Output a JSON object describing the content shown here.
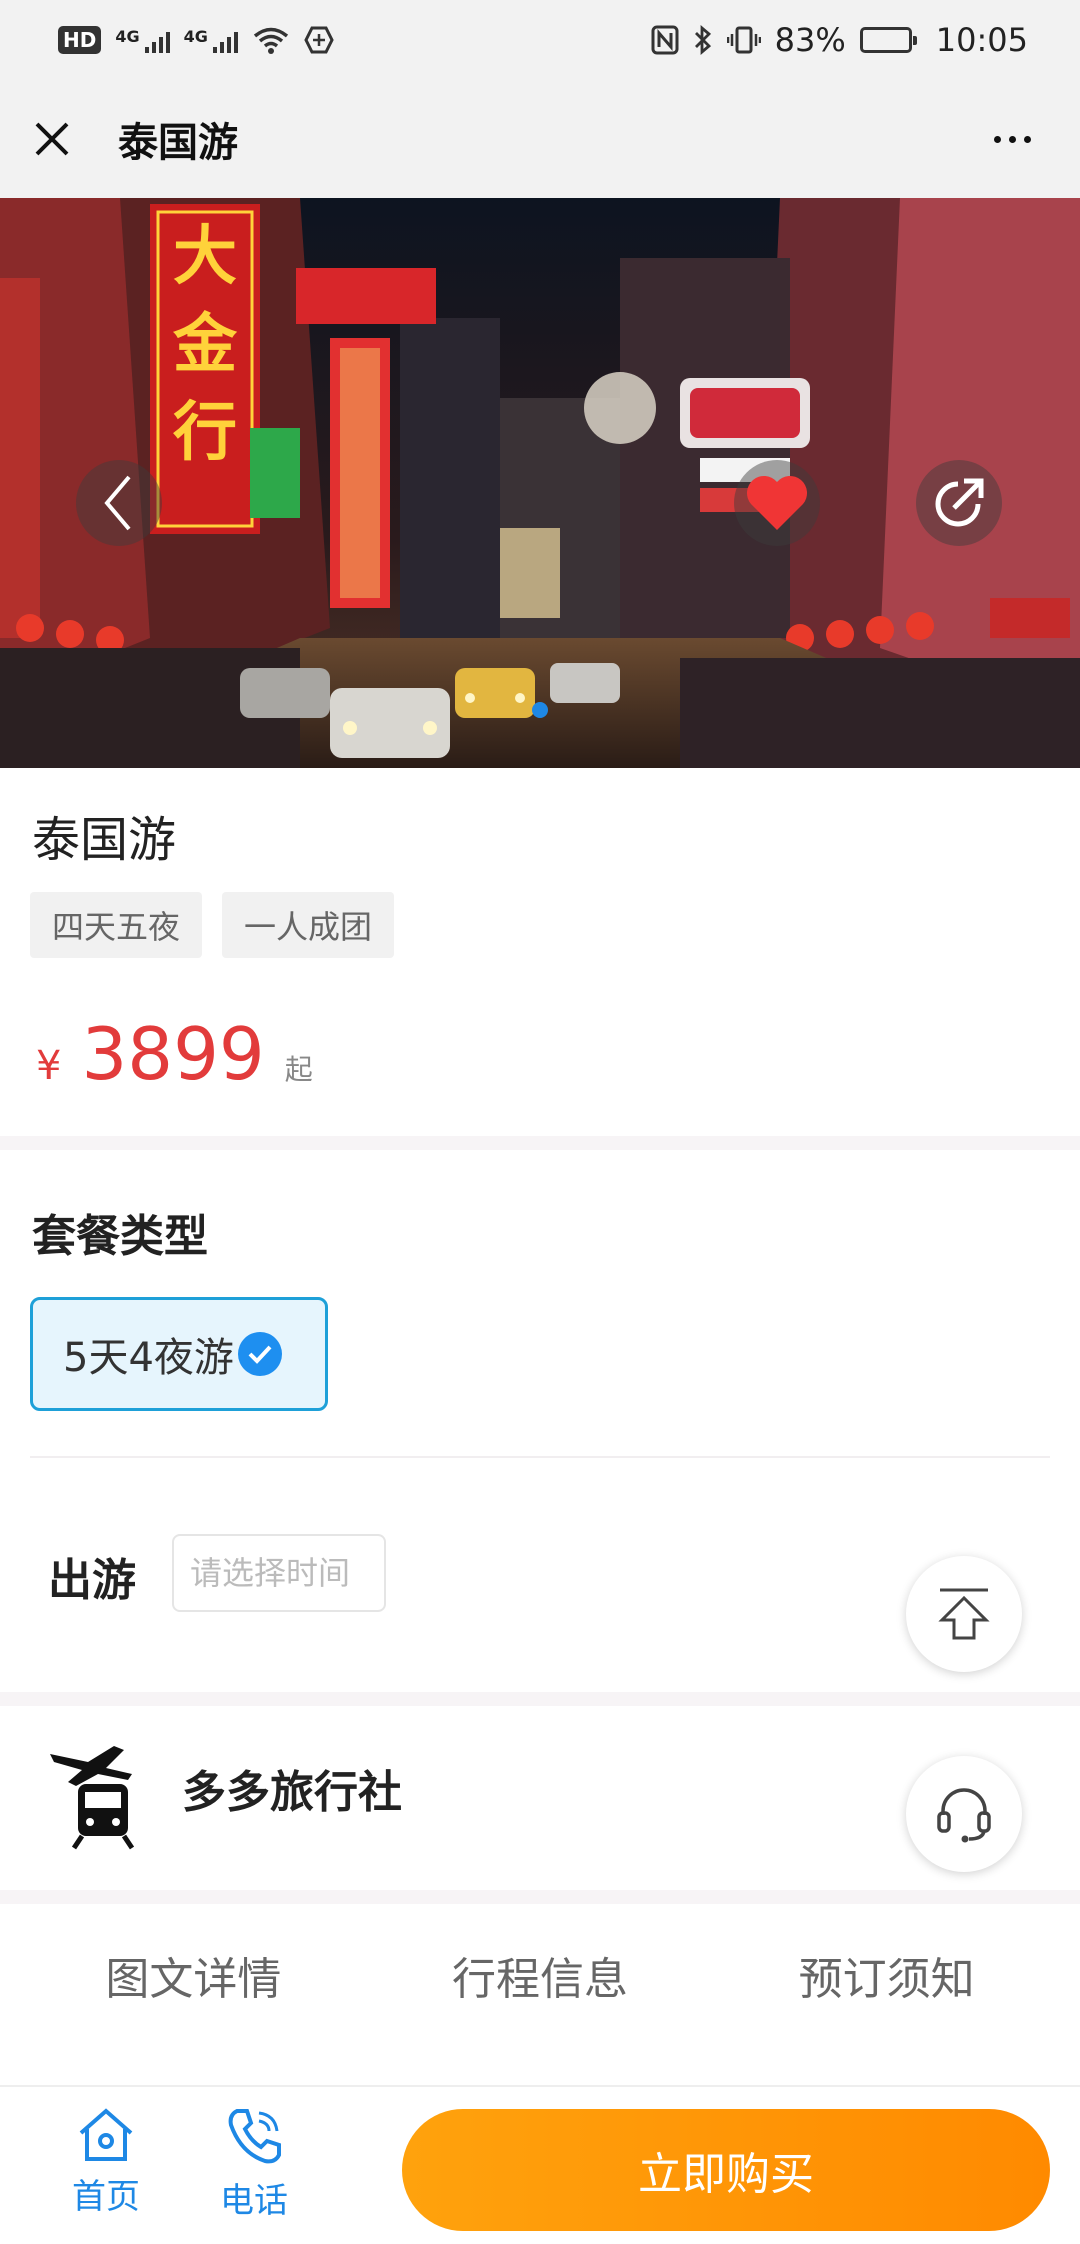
{
  "status_bar": {
    "hd": "HD",
    "net1": "4G",
    "net2": "4G",
    "battery_text": "83%",
    "battery_level": 0.83,
    "time": "10:05"
  },
  "title_bar": {
    "title": "泰国游",
    "close_icon": "close-icon",
    "more_icon": "more-icon"
  },
  "hero": {
    "back_icon": "chevron-left-icon",
    "favorite_icon": "heart-icon",
    "favorite_color": "#f03535",
    "share_icon": "share-icon",
    "signs": [
      "大",
      "金",
      "行"
    ]
  },
  "product": {
    "name": "泰国游",
    "tags": [
      "四天五夜",
      "一人成团"
    ],
    "currency": "¥",
    "price": "3899",
    "price_suffix": "起",
    "price_color": "#e23b3b"
  },
  "package": {
    "title": "套餐类型",
    "options": [
      {
        "label": "5天4夜游",
        "selected": true
      }
    ]
  },
  "departure": {
    "label": "出游",
    "placeholder": "请选择时间"
  },
  "agency": {
    "name": "多多旅行社",
    "logo_icon": "plane-train-icon"
  },
  "tabs": [
    "图文详情",
    "行程信息",
    "预订须知"
  ],
  "bottom_nav": {
    "home_label": "首页",
    "phone_label": "电话",
    "buy_label": "立即购买",
    "accent_color": "#1e88e5",
    "buy_color": "#ff9500"
  }
}
